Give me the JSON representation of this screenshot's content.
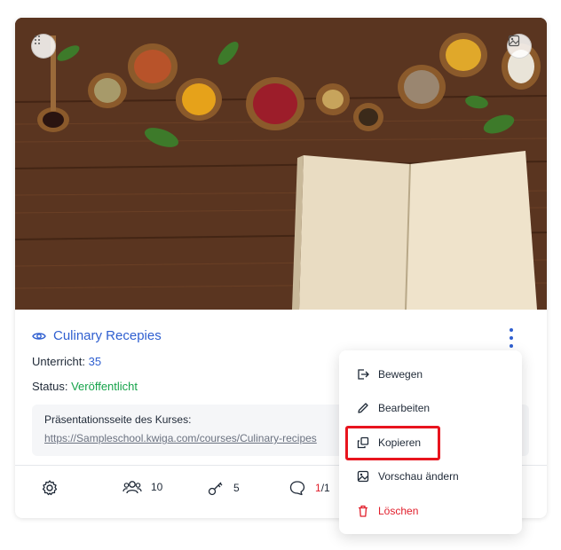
{
  "course": {
    "title": "Culinary Recepies",
    "lessons_label": "Unterricht:",
    "lessons_value": "35",
    "status_label": "Status:",
    "status_value": "Veröffentlicht",
    "presentation_label": "Präsentationsseite des Kurses:",
    "presentation_url": "https://Sampleschool.kwiga.com/courses/Culinary-recipes"
  },
  "stats": {
    "students": "10",
    "keys": "5",
    "comments_new": "1",
    "comments_total": "/1"
  },
  "menu": {
    "items": [
      {
        "label": "Bewegen",
        "icon": "move-icon"
      },
      {
        "label": "Bearbeiten",
        "icon": "pencil-icon"
      },
      {
        "label": "Kopieren",
        "icon": "copy-icon"
      },
      {
        "label": "Vorschau ändern",
        "icon": "image-icon"
      },
      {
        "label": "Löschen",
        "icon": "trash-icon"
      }
    ]
  },
  "colors": {
    "accent": "#2f5fd0",
    "status_green": "#16a34a",
    "danger": "#e11d2a",
    "highlight": "#e8141e"
  }
}
